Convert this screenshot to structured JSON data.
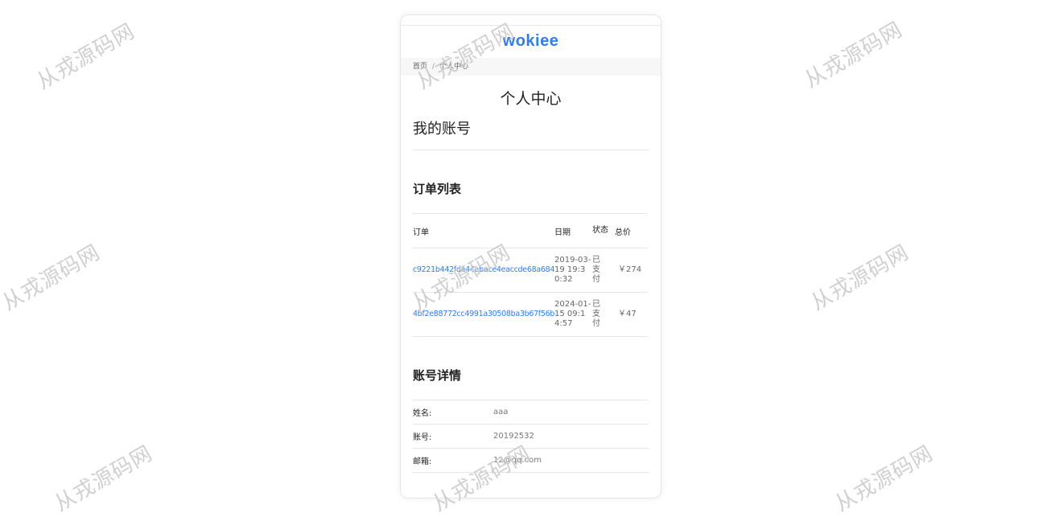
{
  "brand": {
    "logo_text": "wokiee",
    "color": "#2f7cf6"
  },
  "breadcrumb": {
    "home": "首页",
    "separator": "/",
    "current": "个人中心"
  },
  "page_title": "个人中心",
  "account_heading": "我的账号",
  "orders": {
    "title": "订单列表",
    "columns": [
      "订单",
      "日期",
      "状态",
      "总价"
    ],
    "rows": [
      {
        "id": "c9221b442fda44abace4eaccde68a684",
        "date": "2019-03-19 19:30:32",
        "status": "已支付",
        "total": "￥274"
      },
      {
        "id": "4bf2e88772cc4991a30508ba3b67f56b",
        "date": "2024-01-15 09:14:57",
        "status": "已支付",
        "total": "￥47"
      }
    ]
  },
  "details": {
    "title": "账号详情",
    "rows": [
      {
        "label": "姓名:",
        "value": "aaa"
      },
      {
        "label": "账号:",
        "value": "20192532"
      },
      {
        "label": "邮箱:",
        "value": "12@qq.com"
      }
    ]
  },
  "watermark_text": "从戎源码网"
}
